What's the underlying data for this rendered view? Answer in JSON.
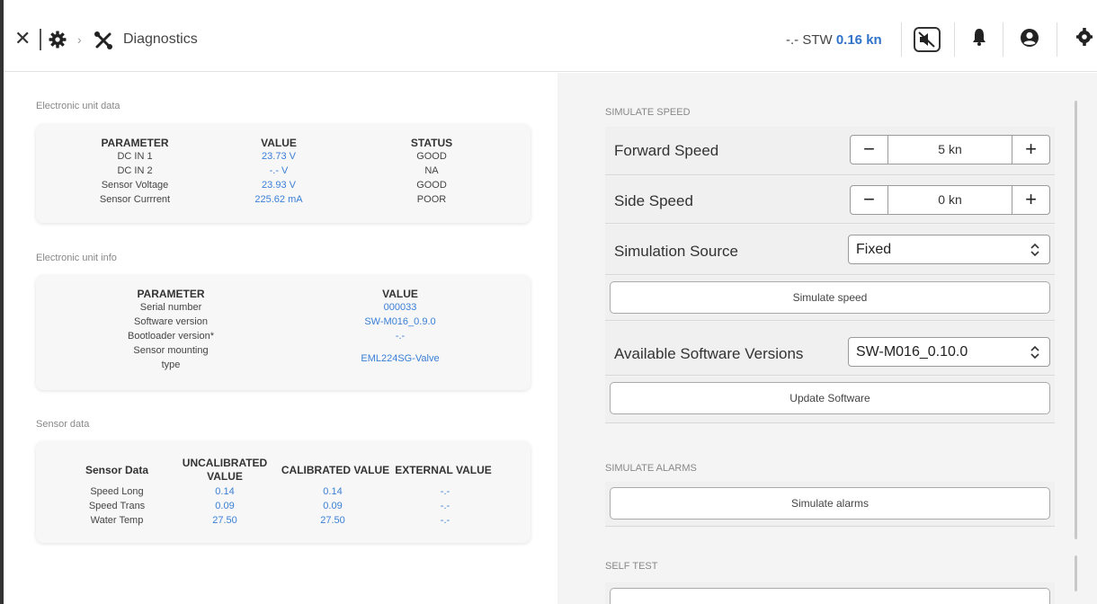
{
  "header": {
    "breadcrumb_title": "Diagnostics",
    "stw_prefix": "-.-  STW",
    "stw_value": "0.16 kn"
  },
  "unit_data": {
    "section_label": "Electronic unit data",
    "headers": [
      "PARAMETER",
      "VALUE",
      "STATUS"
    ],
    "rows": [
      {
        "param": "DC IN 1",
        "value": "23.73 V",
        "status": "GOOD"
      },
      {
        "param": "DC IN 2",
        "value": "-.- V",
        "status": "NA"
      },
      {
        "param": "Sensor Voltage",
        "value": "23.93 V",
        "status": "GOOD"
      },
      {
        "param": "Sensor Currrent",
        "value": "225.62 mA",
        "status": "POOR"
      }
    ]
  },
  "unit_info": {
    "section_label": "Electronic unit info",
    "headers": [
      "PARAMETER",
      "VALUE"
    ],
    "rows": [
      {
        "param": "Serial number",
        "value": "000033"
      },
      {
        "param": "Software version",
        "value": "SW-M016_0.9.0"
      },
      {
        "param": "Bootloader version*",
        "value": "-.-"
      },
      {
        "param": "Sensor mounting type",
        "param_line1": "Sensor mounting",
        "param_line2": "type",
        "value": "EML224SG-Valve"
      }
    ]
  },
  "sensor_data": {
    "section_label": "Sensor data",
    "headers": [
      "Sensor Data",
      "UNCALIBRATED VALUE",
      "CALIBRATED VALUE",
      "EXTERNAL VALUE"
    ],
    "header_uncal_line1": "UNCALIBRATED",
    "header_uncal_line2": "VALUE",
    "rows": [
      {
        "name": "Speed Long",
        "uncal": "0.14",
        "cal": "0.14",
        "ext": "-.-"
      },
      {
        "name": "Speed Trans",
        "uncal": "0.09",
        "cal": "0.09",
        "ext": "-.-"
      },
      {
        "name": "Water Temp",
        "uncal": "27.50",
        "cal": "27.50",
        "ext": "-.-"
      }
    ]
  },
  "simulate_speed": {
    "section_label": "SIMULATE SPEED",
    "forward_label": "Forward Speed",
    "forward_value": "5 kn",
    "side_label": "Side Speed",
    "side_value": "0 kn",
    "source_label": "Simulation Source",
    "source_value": "Fixed",
    "simulate_button": "Simulate speed",
    "versions_label": "Available Software Versions",
    "versions_value": "SW-M016_0.10.0",
    "update_button": "Update Software"
  },
  "simulate_alarms": {
    "section_label": "SIMULATE ALARMS",
    "button": "Simulate alarms"
  },
  "self_test": {
    "section_label": "SELF TEST"
  }
}
